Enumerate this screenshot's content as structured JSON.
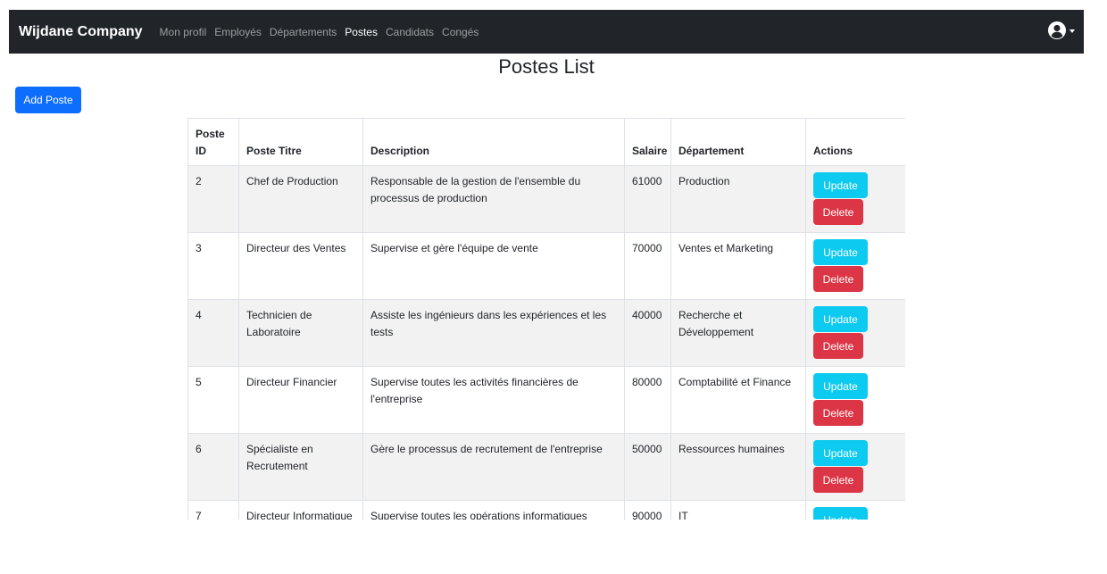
{
  "navbar": {
    "brand": "Wijdane Company",
    "links": [
      {
        "label": "Mon profil",
        "active": false
      },
      {
        "label": "Employés",
        "active": false
      },
      {
        "label": "Départements",
        "active": false
      },
      {
        "label": "Postes",
        "active": true
      },
      {
        "label": "Candidats",
        "active": false
      },
      {
        "label": "Congés",
        "active": false
      }
    ],
    "user_icon": "user-circle-icon"
  },
  "page": {
    "title": "Postes List",
    "add_button": "Add Poste"
  },
  "table": {
    "headers": [
      "Poste ID",
      "Poste Titre",
      "Description",
      "Salaire",
      "Département",
      "Actions"
    ],
    "update_label": "Update",
    "delete_label": "Delete",
    "rows": [
      {
        "id": "2",
        "titre": "Chef de Production",
        "description": "Responsable de la gestion de l'ensemble du processus de production",
        "salaire": "61000",
        "departement": "Production"
      },
      {
        "id": "3",
        "titre": "Directeur des Ventes",
        "description": "Supervise et gère l'équipe de vente",
        "salaire": "70000",
        "departement": "Ventes et Marketing"
      },
      {
        "id": "4",
        "titre": "Technicien de Laboratoire",
        "description": "Assiste les ingénieurs dans les expériences et les tests",
        "salaire": "40000",
        "departement": "Recherche et Développement"
      },
      {
        "id": "5",
        "titre": "Directeur Financier",
        "description": "Supervise toutes les activités financières de l'entreprise",
        "salaire": "80000",
        "departement": "Comptabilité et Finance"
      },
      {
        "id": "6",
        "titre": "Spécialiste en Recrutement",
        "description": "Gère le processus de recrutement de l'entreprise",
        "salaire": "50000",
        "departement": "Ressources humaines"
      },
      {
        "id": "7",
        "titre": "Directeur Informatique",
        "description": "Supervise toutes les opérations informatiques",
        "salaire": "90000",
        "departement": "IT"
      }
    ]
  }
}
